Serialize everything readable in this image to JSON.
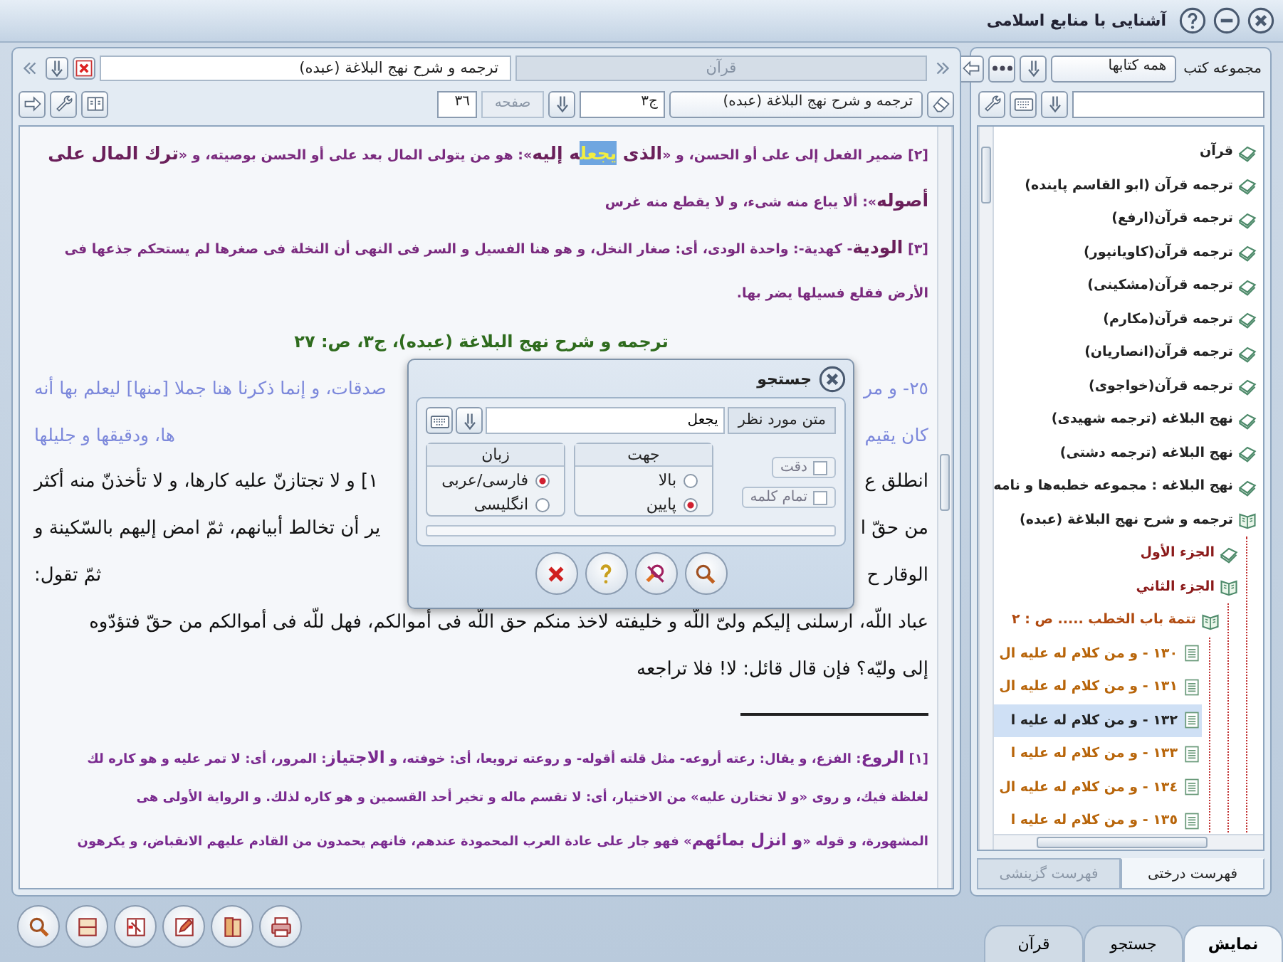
{
  "window": {
    "title": "آشنایی با منابع اسلامی"
  },
  "reader": {
    "tabs": [
      {
        "label": "قرآن",
        "selected": false
      },
      {
        "label": "ترجمه و شرح نهج البلاغة (عبده)",
        "selected": true
      }
    ],
    "book_field": {
      "value": "ترجمه و شرح نهج البلاغة (عبده)"
    },
    "volume_field": {
      "value": "ج٣"
    },
    "page_label": "صفحه",
    "page_field": {
      "value": "٣٦"
    },
    "blocks": [
      {
        "kind": "note",
        "lines": [
          [
            {
              "kind": "text",
              "text": "[٢] ضمير الفعل إلى على أو الحسن، و «"
            },
            {
              "kind": "term",
              "text": "الذى "
            },
            {
              "kind": "match",
              "text": "يجعل"
            },
            {
              "kind": "term",
              "text": "ه إليه"
            },
            {
              "kind": "text",
              "text": "»: هو من يتولى المال بعد على أو الحسن بوصيته، و «"
            },
            {
              "kind": "term",
              "text": "ترك المال على"
            }
          ],
          [
            {
              "kind": "term",
              "text": "أصوله"
            },
            {
              "kind": "text",
              "text": "»: ألا يباع منه شىء، و لا يقطع منه غرس"
            }
          ]
        ]
      },
      {
        "kind": "note",
        "lines": [
          [
            {
              "kind": "text",
              "text": "[٣] "
            },
            {
              "kind": "term",
              "text": "الودية"
            },
            {
              "kind": "text",
              "text": "- كهدية-: واحدة الودى، أى: صغار النخل، و هو هنا الفسيل و السر فى النهى أن النخلة فى صغرها لم يستحكم جذعها فى"
            }
          ],
          [
            {
              "kind": "text",
              "text": "الأرض فقلع فسيلها يضر بها."
            }
          ]
        ]
      },
      {
        "kind": "heading",
        "lines": [
          [
            {
              "kind": "text",
              "text": "ترجمه و شرح نهج البلاغة (عبده)، ج٣، ص: ٢٧"
            }
          ]
        ]
      },
      {
        "kind": "quote",
        "lines": [
          [
            {
              "kind": "text",
              "text": "٢٥- و مر"
            },
            {
              "kind": "covered"
            },
            {
              "kind": "text",
              "text": "صدقات، و إنما ذكرنا هنا جملا [منها] ليعلم بها أنه"
            }
          ],
          [
            {
              "kind": "text",
              "text": "كان يقيم"
            },
            {
              "kind": "covered"
            },
            {
              "kind": "text",
              "text": "ها، ودقيقها و جليلها"
            }
          ]
        ]
      },
      {
        "kind": "body",
        "lines": [
          [
            {
              "kind": "text",
              "text": "انطلق ع"
            },
            {
              "kind": "covered"
            },
            {
              "kind": "text",
              "text": "١] و لا تجتازنّ عليه كارها، و لا تأخذنّ منه أكثر"
            }
          ],
          [
            {
              "kind": "text",
              "text": "من حقّ ا"
            },
            {
              "kind": "covered"
            },
            {
              "kind": "text",
              "text": "ير أن تخالط أبيانهم، ثمّ امض إليهم بالسّكينة و"
            }
          ],
          [
            {
              "kind": "text",
              "text": "الوقار ح"
            },
            {
              "kind": "covered"
            },
            {
              "kind": "text",
              "text": "ثمّ تقول:"
            }
          ],
          [
            {
              "kind": "text",
              "text": "عباد اللّه، ارسلنى إليكم ولىّ اللّه و خليفته لاخذ منكم حق اللّه فى أموالكم، فهل للّه فى أموالكم من حقّ فتؤدّوه"
            }
          ],
          [
            {
              "kind": "text",
              "text": "إلى وليّه؟ فإن قال قائل: لا! فلا تراجعه"
            }
          ]
        ]
      },
      {
        "kind": "rule"
      },
      {
        "kind": "footnote",
        "lines": [
          [
            {
              "kind": "text",
              "text": "[١] "
            },
            {
              "kind": "term",
              "text": "الروع"
            },
            {
              "kind": "text",
              "text": ": الفزع، و يقال: رعته أروعه- مثل قلته أقوله- و روعته ترويعا، أى: خوفته، و "
            },
            {
              "kind": "term",
              "text": "الاجتياز"
            },
            {
              "kind": "text",
              "text": ": المرور، أى: لا تمر عليه و هو كاره لك"
            }
          ],
          [
            {
              "kind": "text",
              "text": "لغلظة فيك، و روى «و لا تختارن عليه» من الاختيار، أى: لا تقسم ماله و تخير أحد القسمين و هو كاره لذلك. و الرواية الأولى هى"
            }
          ],
          [
            {
              "kind": "text",
              "text": "المشهورة، و قوله «"
            },
            {
              "kind": "term",
              "text": "و انزل بمائهم"
            },
            {
              "kind": "text",
              "text": "» فهو جار على عادة العرب المحمودة عندهم، فانهم يحمدون من القادم عليهم الانقباض، و يكرهون"
            }
          ]
        ]
      }
    ]
  },
  "search_dialog": {
    "title": "جستجو",
    "query_label": "متن مورد نظر",
    "query": {
      "value": "يجعل"
    },
    "options": [
      {
        "label": "دقت",
        "checked": false
      },
      {
        "label": "تمام کلمه",
        "checked": false
      }
    ],
    "groups": [
      {
        "title": "جهت",
        "options": [
          {
            "label": "بالا",
            "selected": false
          },
          {
            "label": "پایین",
            "selected": true
          }
        ]
      },
      {
        "title": "زبان",
        "options": [
          {
            "label": "فارسی/عربی",
            "selected": true
          },
          {
            "label": "انگلیسی",
            "selected": false
          }
        ]
      }
    ],
    "progress": {
      "level": 0
    }
  },
  "library": {
    "collection_label": "مجموعه کتب",
    "collection_field": {
      "value": "همه کتابها"
    },
    "tree": [
      {
        "label": "قرآن",
        "kind": "book",
        "expanded": false,
        "selected": false,
        "color": "#222222"
      },
      {
        "label": "ترجمه قرآن (ابو القاسم پاینده)",
        "kind": "book",
        "expanded": false,
        "selected": false,
        "color": "#222222"
      },
      {
        "label": "ترجمه قرآن(ارفع)",
        "kind": "book",
        "expanded": false,
        "selected": false,
        "color": "#222222"
      },
      {
        "label": "ترجمه قرآن(کاویانپور)",
        "kind": "book",
        "expanded": false,
        "selected": false,
        "color": "#222222"
      },
      {
        "label": "ترجمه قرآن(مشکینی)",
        "kind": "book",
        "expanded": false,
        "selected": false,
        "color": "#222222"
      },
      {
        "label": "ترجمه قرآن(مکارم)",
        "kind": "book",
        "expanded": false,
        "selected": false,
        "color": "#222222"
      },
      {
        "label": "ترجمه قرآن(انصاریان)",
        "kind": "book",
        "expanded": false,
        "selected": false,
        "color": "#222222"
      },
      {
        "label": "ترجمه قرآن(خواجوی)",
        "kind": "book",
        "expanded": false,
        "selected": false,
        "color": "#222222"
      },
      {
        "label": "نهج البلاغه (ترجمه شهیدی)",
        "kind": "book",
        "expanded": false,
        "selected": false,
        "color": "#222222"
      },
      {
        "label": "نهج البلاغه (ترجمه دشتی)",
        "kind": "book",
        "expanded": false,
        "selected": false,
        "color": "#222222"
      },
      {
        "label": "نهج البلاغه : مجموعه خطبه‌ها و نامه",
        "kind": "book",
        "expanded": false,
        "selected": false,
        "color": "#222222"
      },
      {
        "label": "ترجمه و شرح نهج البلاغة (عبده)",
        "kind": "book",
        "expanded": true,
        "selected": false,
        "color": "#222222",
        "children": [
          {
            "label": "الجزء الأول",
            "kind": "book",
            "expanded": false,
            "selected": false,
            "color": "#8b1a1a"
          },
          {
            "label": "الجزء الثاني",
            "kind": "book",
            "expanded": true,
            "selected": false,
            "color": "#8b1a1a",
            "children": [
              {
                "label": "تتمة باب الخطب ..... ص : ٢",
                "kind": "book",
                "expanded": true,
                "selected": false,
                "color": "#b04a10",
                "children": [
                  {
                    "label": "١٣٠ - و من كلام له عليه ال",
                    "kind": "page",
                    "selected": false,
                    "color": "#b8650a"
                  },
                  {
                    "label": "١٣١ - و من كلام له عليه ال",
                    "kind": "page",
                    "selected": false,
                    "color": "#b8650a"
                  },
                  {
                    "label": "١٣٢ - و من كلام له عليه ا",
                    "kind": "page",
                    "selected": true,
                    "color": "#222222"
                  },
                  {
                    "label": "١٣٣ - و من كلام له عليه ا",
                    "kind": "page",
                    "selected": false,
                    "color": "#b8650a"
                  },
                  {
                    "label": "١٣٤ - و من كلام له عليه ال",
                    "kind": "page",
                    "selected": false,
                    "color": "#b8650a"
                  },
                  {
                    "label": "١٣٥ - و من كلام له عليه ا",
                    "kind": "page",
                    "selected": false,
                    "color": "#b8650a"
                  }
                ]
              }
            ]
          }
        ]
      }
    ],
    "panel_tabs": [
      {
        "label": "فهرست درختی",
        "selected": true
      },
      {
        "label": "فهرست گزینشی",
        "selected": false
      }
    ]
  },
  "bottom_tabs": [
    {
      "label": "نمایش",
      "selected": true
    },
    {
      "label": "جستجو",
      "selected": false
    },
    {
      "label": "قرآن",
      "selected": false
    }
  ]
}
